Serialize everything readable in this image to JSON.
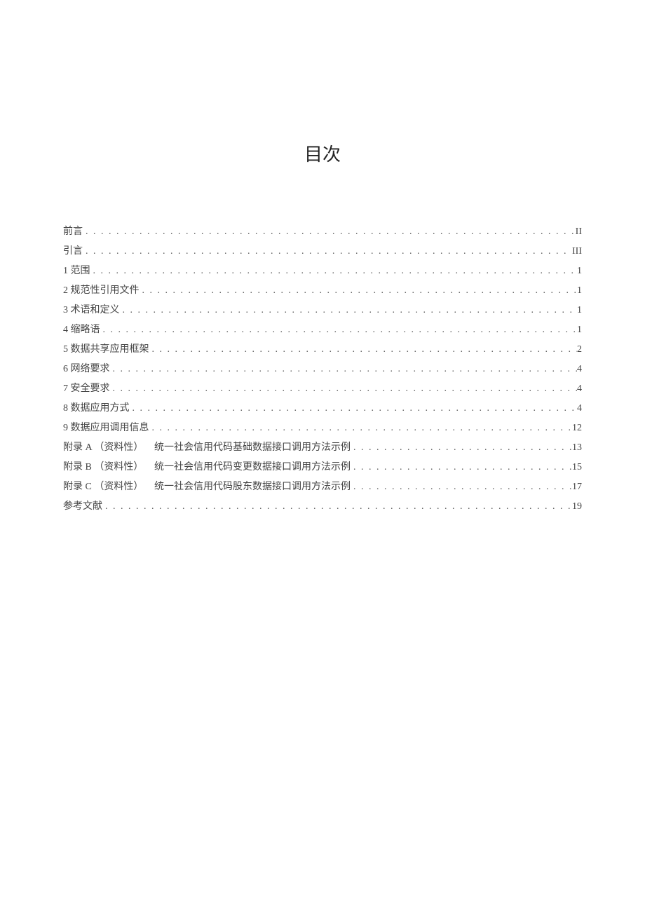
{
  "title": "目次",
  "toc": {
    "items": [
      {
        "label": "前言",
        "page": "II"
      },
      {
        "label": "引言",
        "page": "III"
      },
      {
        "label": "1 范围",
        "page": "1"
      },
      {
        "label": "2 规范性引用文件",
        "page": "1"
      },
      {
        "label": "3 术语和定义",
        "page": "1"
      },
      {
        "label": "4 缩略语",
        "page": "1"
      },
      {
        "label": "5 数据共享应用框架",
        "page": "2"
      },
      {
        "label": "6 网络要求",
        "page": "4"
      },
      {
        "label": "7 安全要求",
        "page": "4"
      },
      {
        "label": "8 数据应用方式",
        "page": "4"
      },
      {
        "label": "9 数据应用调用信息",
        "page": "12"
      },
      {
        "prefix": "附录 A （资料性）",
        "label": "统一社会信用代码基础数据接口调用方法示例",
        "page": "13"
      },
      {
        "prefix": "附录 B （资料性）",
        "label": "统一社会信用代码变更数据接口调用方法示例",
        "page": "15"
      },
      {
        "prefix": "附录 C （资料性）",
        "label": "统一社会信用代码股东数据接口调用方法示例",
        "page": "17"
      },
      {
        "label": "参考文献",
        "page": "19"
      }
    ]
  }
}
